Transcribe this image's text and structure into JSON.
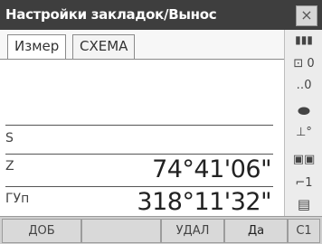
{
  "window": {
    "title": "Настройки закладок/Вынос",
    "close_label": "×"
  },
  "tabs": [
    {
      "label": "Измер",
      "active": true
    },
    {
      "label": "СХЕМА",
      "active": false
    }
  ],
  "measurements": {
    "s": {
      "label": "S",
      "value": ""
    },
    "z": {
      "label": "Z",
      "value": "74°41'06\""
    },
    "hz": {
      "label": "ГУп",
      "value": "318°11'32\""
    }
  },
  "side_icons": [
    {
      "name": "battery-icon",
      "glyph": "▮▮▮"
    },
    {
      "name": "target-icon",
      "glyph": "⊡ 0"
    },
    {
      "name": "prism-constant-icon",
      "glyph": "‥0"
    },
    {
      "name": "laser-icon",
      "glyph": "⬬"
    },
    {
      "name": "tilt-icon",
      "glyph": "⊥°"
    },
    {
      "name": "memory-icon",
      "glyph": "▣▣"
    },
    {
      "name": "level-icon",
      "glyph": "⌐1"
    },
    {
      "name": "keyboard-icon",
      "glyph": "▤"
    }
  ],
  "buttons": {
    "add": "ДОБ",
    "empty": "",
    "delete": "УДАЛ",
    "yes": "Да",
    "page": "C1"
  }
}
